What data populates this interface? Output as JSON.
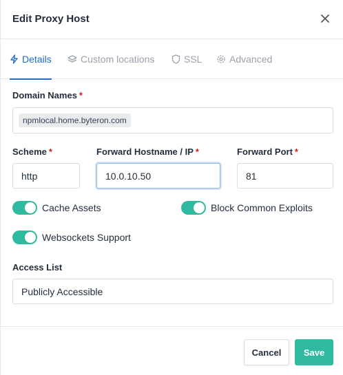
{
  "dialog": {
    "title": "Edit Proxy Host",
    "close_icon": "close-icon"
  },
  "tabs": [
    {
      "label": "Details",
      "icon": "lightning-icon",
      "active": true
    },
    {
      "label": "Custom locations",
      "icon": "layers-icon",
      "active": false
    },
    {
      "label": "SSL",
      "icon": "shield-icon",
      "active": false
    },
    {
      "label": "Advanced",
      "icon": "gear-icon",
      "active": false
    }
  ],
  "form": {
    "domain_names": {
      "label": "Domain Names",
      "required": "*",
      "values": [
        "npmlocal.home.byteron.com"
      ]
    },
    "scheme": {
      "label": "Scheme",
      "required": "*",
      "value": "http"
    },
    "forward_host": {
      "label": "Forward Hostname / IP",
      "required": "*",
      "value": "10.0.10.50"
    },
    "forward_port": {
      "label": "Forward Port",
      "required": "*",
      "value": "81"
    },
    "toggles": {
      "cache_assets": {
        "label": "Cache Assets",
        "on": true
      },
      "block_exploits": {
        "label": "Block Common Exploits",
        "on": true
      },
      "websockets": {
        "label": "Websockets Support",
        "on": true
      }
    },
    "access_list": {
      "label": "Access List",
      "value": "Publicly Accessible"
    }
  },
  "footer": {
    "cancel_label": "Cancel",
    "save_label": "Save"
  },
  "colors": {
    "accent": "#206bc4",
    "toggle_on": "#2fb99f",
    "save_button": "#2fb99f",
    "required": "#cd201f"
  }
}
